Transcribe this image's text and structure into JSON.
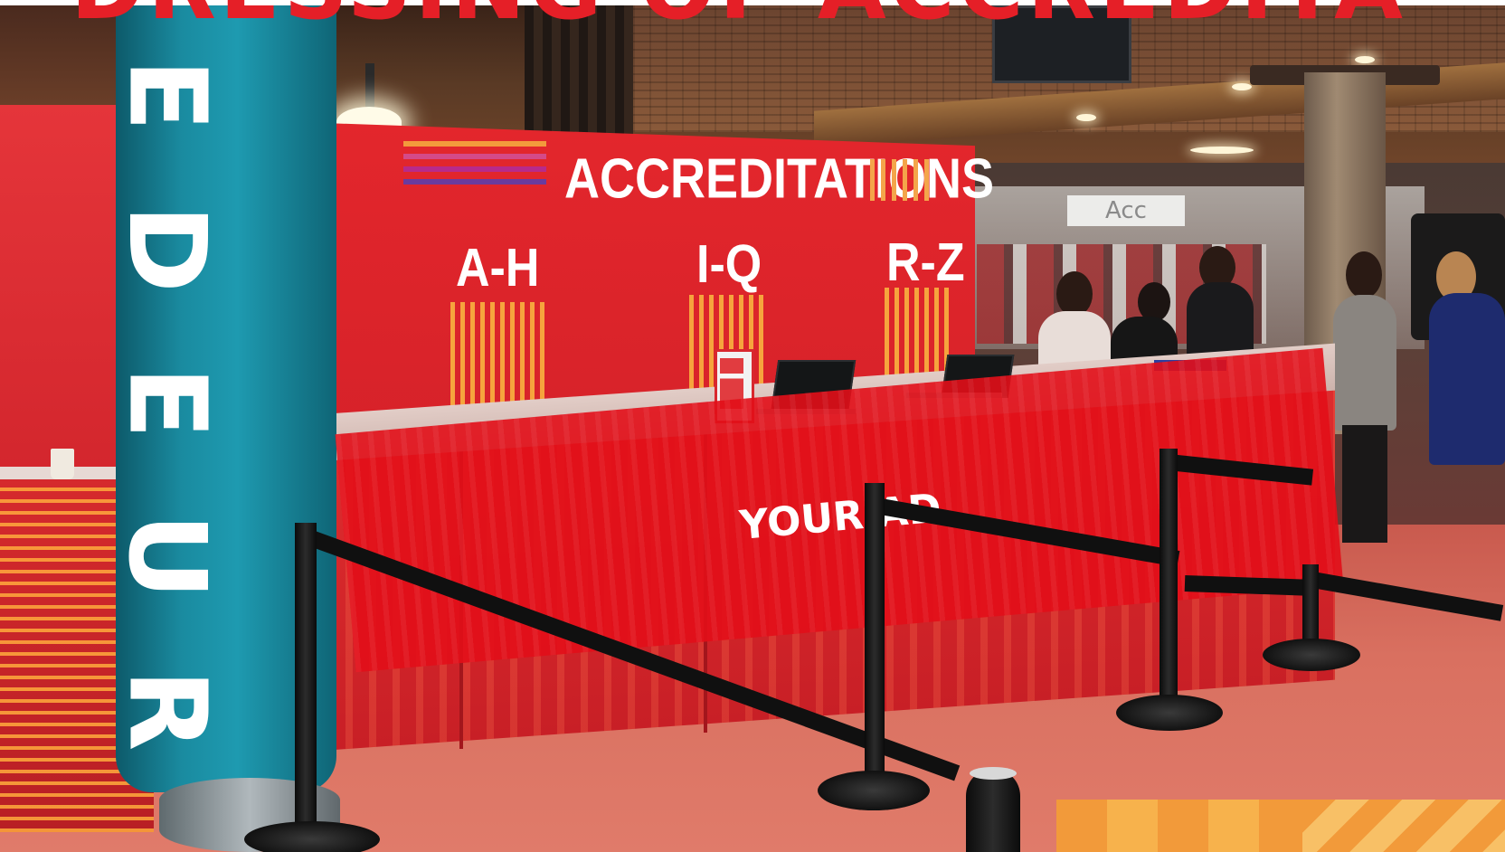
{
  "headline": "DRESSING OF ACCREDITA",
  "backdrop": {
    "title": "ACCREDITATIONS",
    "ranges": [
      "A-H",
      "I-Q",
      "R-Z"
    ]
  },
  "ad": {
    "label": "YOUR AD"
  },
  "column": {
    "letters": [
      "E",
      "D",
      "E",
      "U",
      "R"
    ]
  },
  "background_sign": "Acc",
  "colors": {
    "brand_red": "#e51f27",
    "teal": "#1a8ba0",
    "orange_accent": "#f29a3a",
    "floor": "#d97060"
  }
}
